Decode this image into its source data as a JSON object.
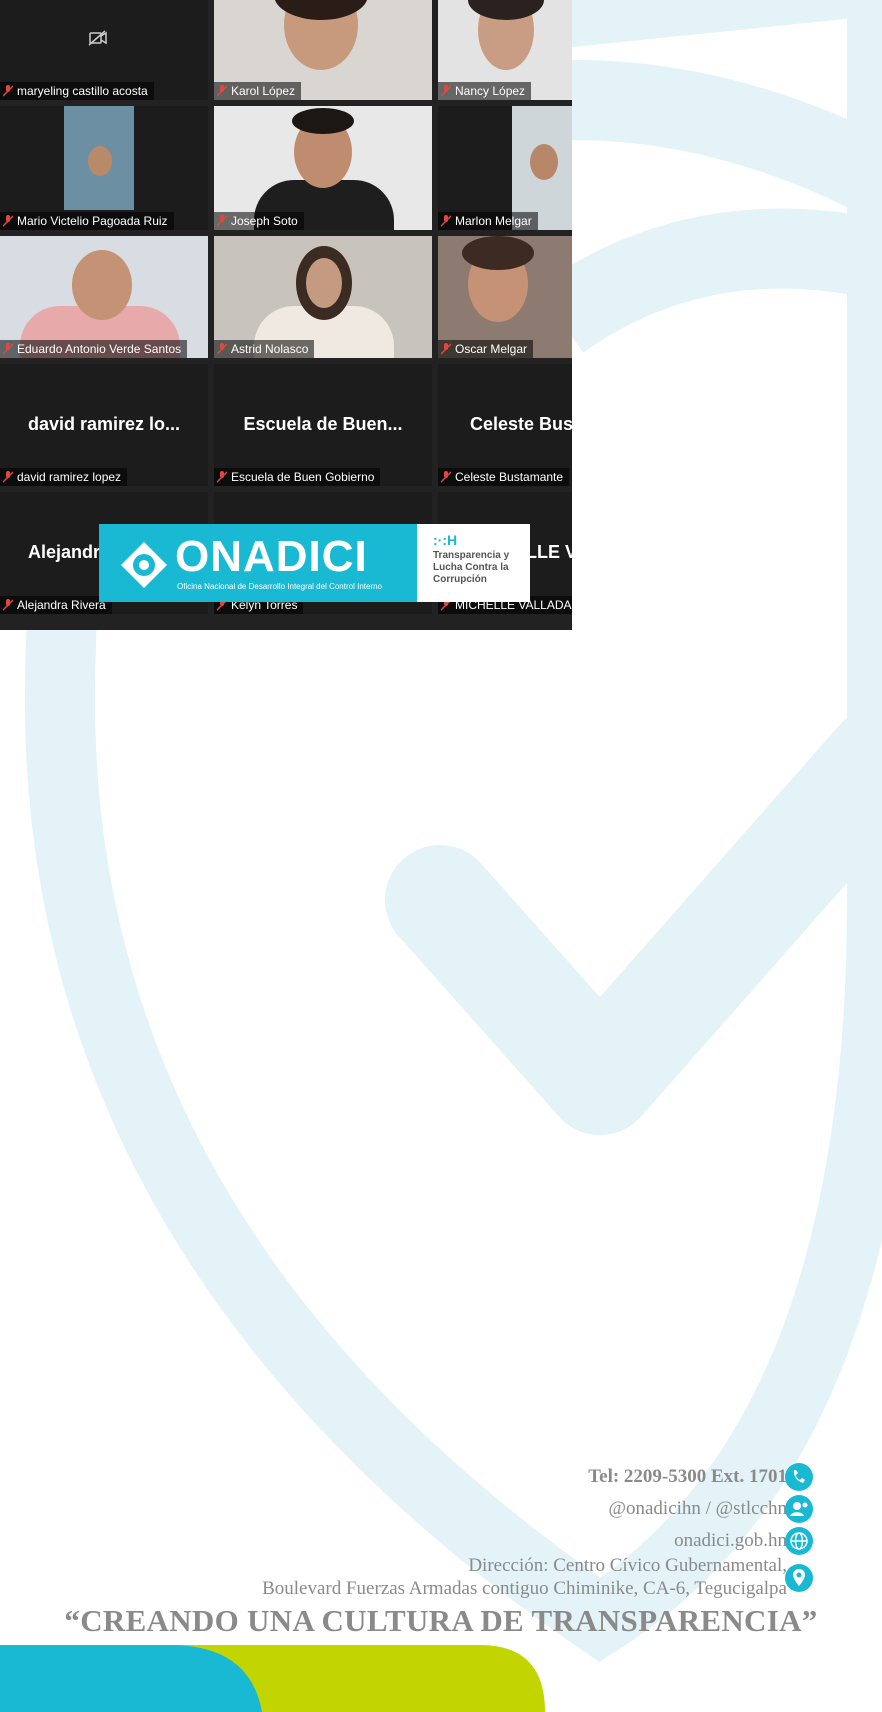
{
  "participants": [
    {
      "name": "maryeling castillo acosta",
      "video": false
    },
    {
      "name": "Karol López",
      "video": true
    },
    {
      "name": "Nancy López",
      "video": true
    },
    {
      "name": "Mario Victelio Pagoada Ruiz",
      "video": true
    },
    {
      "name": "Joseph Soto",
      "video": true
    },
    {
      "name": "Marlon Melgar",
      "video": true
    },
    {
      "name": "Eduardo Antonio Verde Santos",
      "video": true
    },
    {
      "name": "Astrid Nolasco",
      "video": true
    },
    {
      "name": "Oscar Melgar",
      "video": true
    },
    {
      "name": "david ramirez lopez",
      "display": "david ramirez lo...",
      "video": false
    },
    {
      "name": "Escuela de Buen Gobierno",
      "display": "Escuela de Buen...",
      "video": false
    },
    {
      "name": "Celeste Bustamante",
      "display": "Celeste  Bus",
      "video": false
    },
    {
      "name": "Alejandra Rivera",
      "display": "Alejandr",
      "video": false
    },
    {
      "name": "Kelyn Torres",
      "video": false
    },
    {
      "name": "MICHELLE VALLADA",
      "display": "LLE V",
      "video": false
    }
  ],
  "banner": {
    "brand": "ONADICI",
    "subtitle": "Oficina Nacional de Desarrollo Integral del Control Interno",
    "partner_mark": ":·:H",
    "partner_text": "Transparencia y Lucha Contra la Corrupción"
  },
  "contact": {
    "tel": "Tel: 2209-5300   Ext. 1701",
    "social": "@onadicihn / @stlcchn",
    "web": "onadici.gob.hn",
    "address_line1": "Dirección: Centro Cívico Gubernamental,",
    "address_line2": "Boulevard Fuerzas Armadas contiguo Chiminike, CA-6, Tegucigalpa"
  },
  "slogan": "“CREANDO UNA CULTURA DE TRANSPARENCIA”",
  "colors": {
    "accent": "#19b9d4",
    "lime": "#c3d500",
    "watermark": "#e3f3f8",
    "text_gray": "#8a8a8a"
  },
  "icons": [
    "camera-off-icon",
    "mic-muted-icon",
    "phone-icon",
    "social-icon",
    "globe-icon",
    "location-pin-icon"
  ]
}
